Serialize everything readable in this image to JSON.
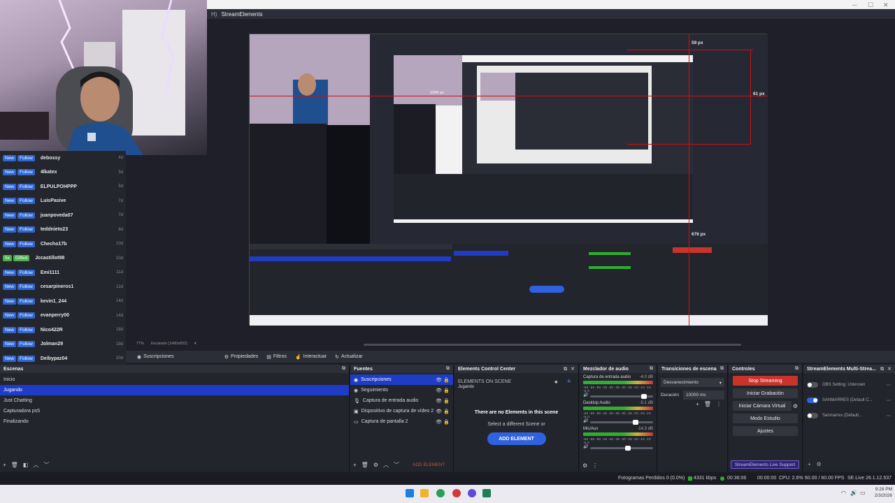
{
  "window": {
    "title": "StreamElements",
    "title_prefix": "H)"
  },
  "follows": [
    {
      "type": "follow",
      "badge1": "New",
      "badge2": "Follow",
      "name": "debossy",
      "time": "4d"
    },
    {
      "type": "follow",
      "badge1": "New",
      "badge2": "Follow",
      "name": "4lkatex",
      "time": "5d"
    },
    {
      "type": "follow",
      "badge1": "New",
      "badge2": "Follow",
      "name": "ELPULPOHPPP",
      "time": "5d"
    },
    {
      "type": "follow",
      "badge1": "New",
      "badge2": "Follow",
      "name": "LuisPasive",
      "time": "7d"
    },
    {
      "type": "follow",
      "badge1": "New",
      "badge2": "Follow",
      "name": "juanpoveda07",
      "time": "7d"
    },
    {
      "type": "follow",
      "badge1": "New",
      "badge2": "Follow",
      "name": "teddnieto23",
      "time": "8d"
    },
    {
      "type": "follow",
      "badge1": "New",
      "badge2": "Follow",
      "name": "Checho17b",
      "time": "10d"
    },
    {
      "type": "gift",
      "badge1": "5x",
      "badge2": "Gifted",
      "name": "Jccastillot98",
      "time": "10d"
    },
    {
      "type": "follow",
      "badge1": "New",
      "badge2": "Follow",
      "name": "Emi1111",
      "time": "11d"
    },
    {
      "type": "follow",
      "badge1": "New",
      "badge2": "Follow",
      "name": "cesarpineros1",
      "time": "12d"
    },
    {
      "type": "follow",
      "badge1": "New",
      "badge2": "Follow",
      "name": "kevin1_244",
      "time": "14d"
    },
    {
      "type": "follow",
      "badge1": "New",
      "badge2": "Follow",
      "name": "evanperry00",
      "time": "14d"
    },
    {
      "type": "follow",
      "badge1": "New",
      "badge2": "Follow",
      "name": "Nico422R",
      "time": "18d"
    },
    {
      "type": "follow",
      "badge1": "New",
      "badge2": "Follow",
      "name": "Jolman29",
      "time": "19d"
    },
    {
      "type": "follow",
      "badge1": "New",
      "badge2": "Follow",
      "name": "Deibypaz04",
      "time": "20d"
    }
  ],
  "preview": {
    "labels": {
      "top": "59 px",
      "right": "61 px",
      "left": "1399 px",
      "bottom": "676 px"
    },
    "zoom": "77%",
    "scaling": "Escalado (1480x832)"
  },
  "source_toolbar": {
    "selected_source": "Suscripciones",
    "properties": "Propiedades",
    "filters": "Filtros",
    "interact": "Interactuar",
    "refresh": "Actualizar"
  },
  "scenes": {
    "title": "Escenas",
    "items": [
      "Inicio",
      "Jugando",
      "Just Chatting",
      "Capturadora ps5",
      "Finalizando"
    ],
    "selected_index": 1
  },
  "sources": {
    "title": "Fuentes",
    "items": [
      {
        "icon": "globe-icon",
        "name": "Suscripciones"
      },
      {
        "icon": "globe-icon",
        "name": "Seguimiento"
      },
      {
        "icon": "mic-icon",
        "name": "Captura de entrada audio"
      },
      {
        "icon": "camera-icon",
        "name": "Dispositivo de captura de vídeo 2"
      },
      {
        "icon": "monitor-icon",
        "name": "Captura de pantalla 2"
      }
    ],
    "selected_index": 0,
    "add_element": "ADD ELEMENT"
  },
  "elements": {
    "title": "Elements Control Center",
    "on_scene": "ELEMENTS ON SCENE",
    "scene_name": "Jugando",
    "empty_title": "There are no Elements in this scene",
    "empty_sub": "Select a different Scene or",
    "add_button": "ADD ELEMENT"
  },
  "mixer": {
    "title": "Mezclador de audio",
    "channels": [
      {
        "name": "Captura de entrada audio",
        "db": "-4.0 dB",
        "level": 0.85
      },
      {
        "name": "Desktop Audio",
        "db": "-5.1 dB",
        "level": 0.72
      },
      {
        "name": "Mic/Aux",
        "db": "-14.3 dB",
        "level": 0.6
      }
    ],
    "ticks": "-60 -55 -50 -45 -40 -35 -30 -25 -20 -15 -10 -5 0"
  },
  "transitions": {
    "title": "Transiciones de escena",
    "selected": "Desvanecimiento",
    "duration_label": "Duración",
    "duration_value": "10000 ms"
  },
  "controls": {
    "title": "Controles",
    "stop_streaming": "Stop Streaming",
    "start_recording": "Iniciar Grabación",
    "virtual_camera": "Iniciar Cámara Virtual",
    "studio_mode": "Modo Estudio",
    "settings": "Ajustes"
  },
  "multistream": {
    "title": "StreamElements Multi-Strea...",
    "rows": [
      {
        "label": "OBS Setting: Unknown",
        "enabled": false
      },
      {
        "label": "SANMARRES (Default C...",
        "enabled": true
      },
      {
        "label": "Sanmarres (Default...",
        "enabled": false
      }
    ],
    "support": "StreamElements Live Support"
  },
  "status": {
    "dropped": "Fotogramas Perdidos 0 (0.0%)",
    "bitrate": "4331 kbps",
    "stream_time": "00:36:06",
    "rec_time": "00:00:00",
    "cpu": "CPU: 2.6%",
    "fps": "60.00 / 60.00 FPS",
    "version": "SE.Live 26.1.12.537"
  },
  "clock": {
    "time": "9:28 PM",
    "date": "2/3/2026"
  },
  "colors": {
    "accent": "#1e3cc6",
    "stop": "#c8332c",
    "follow_badge": "#2e67d4",
    "gift_badge": "#4bb04b"
  }
}
